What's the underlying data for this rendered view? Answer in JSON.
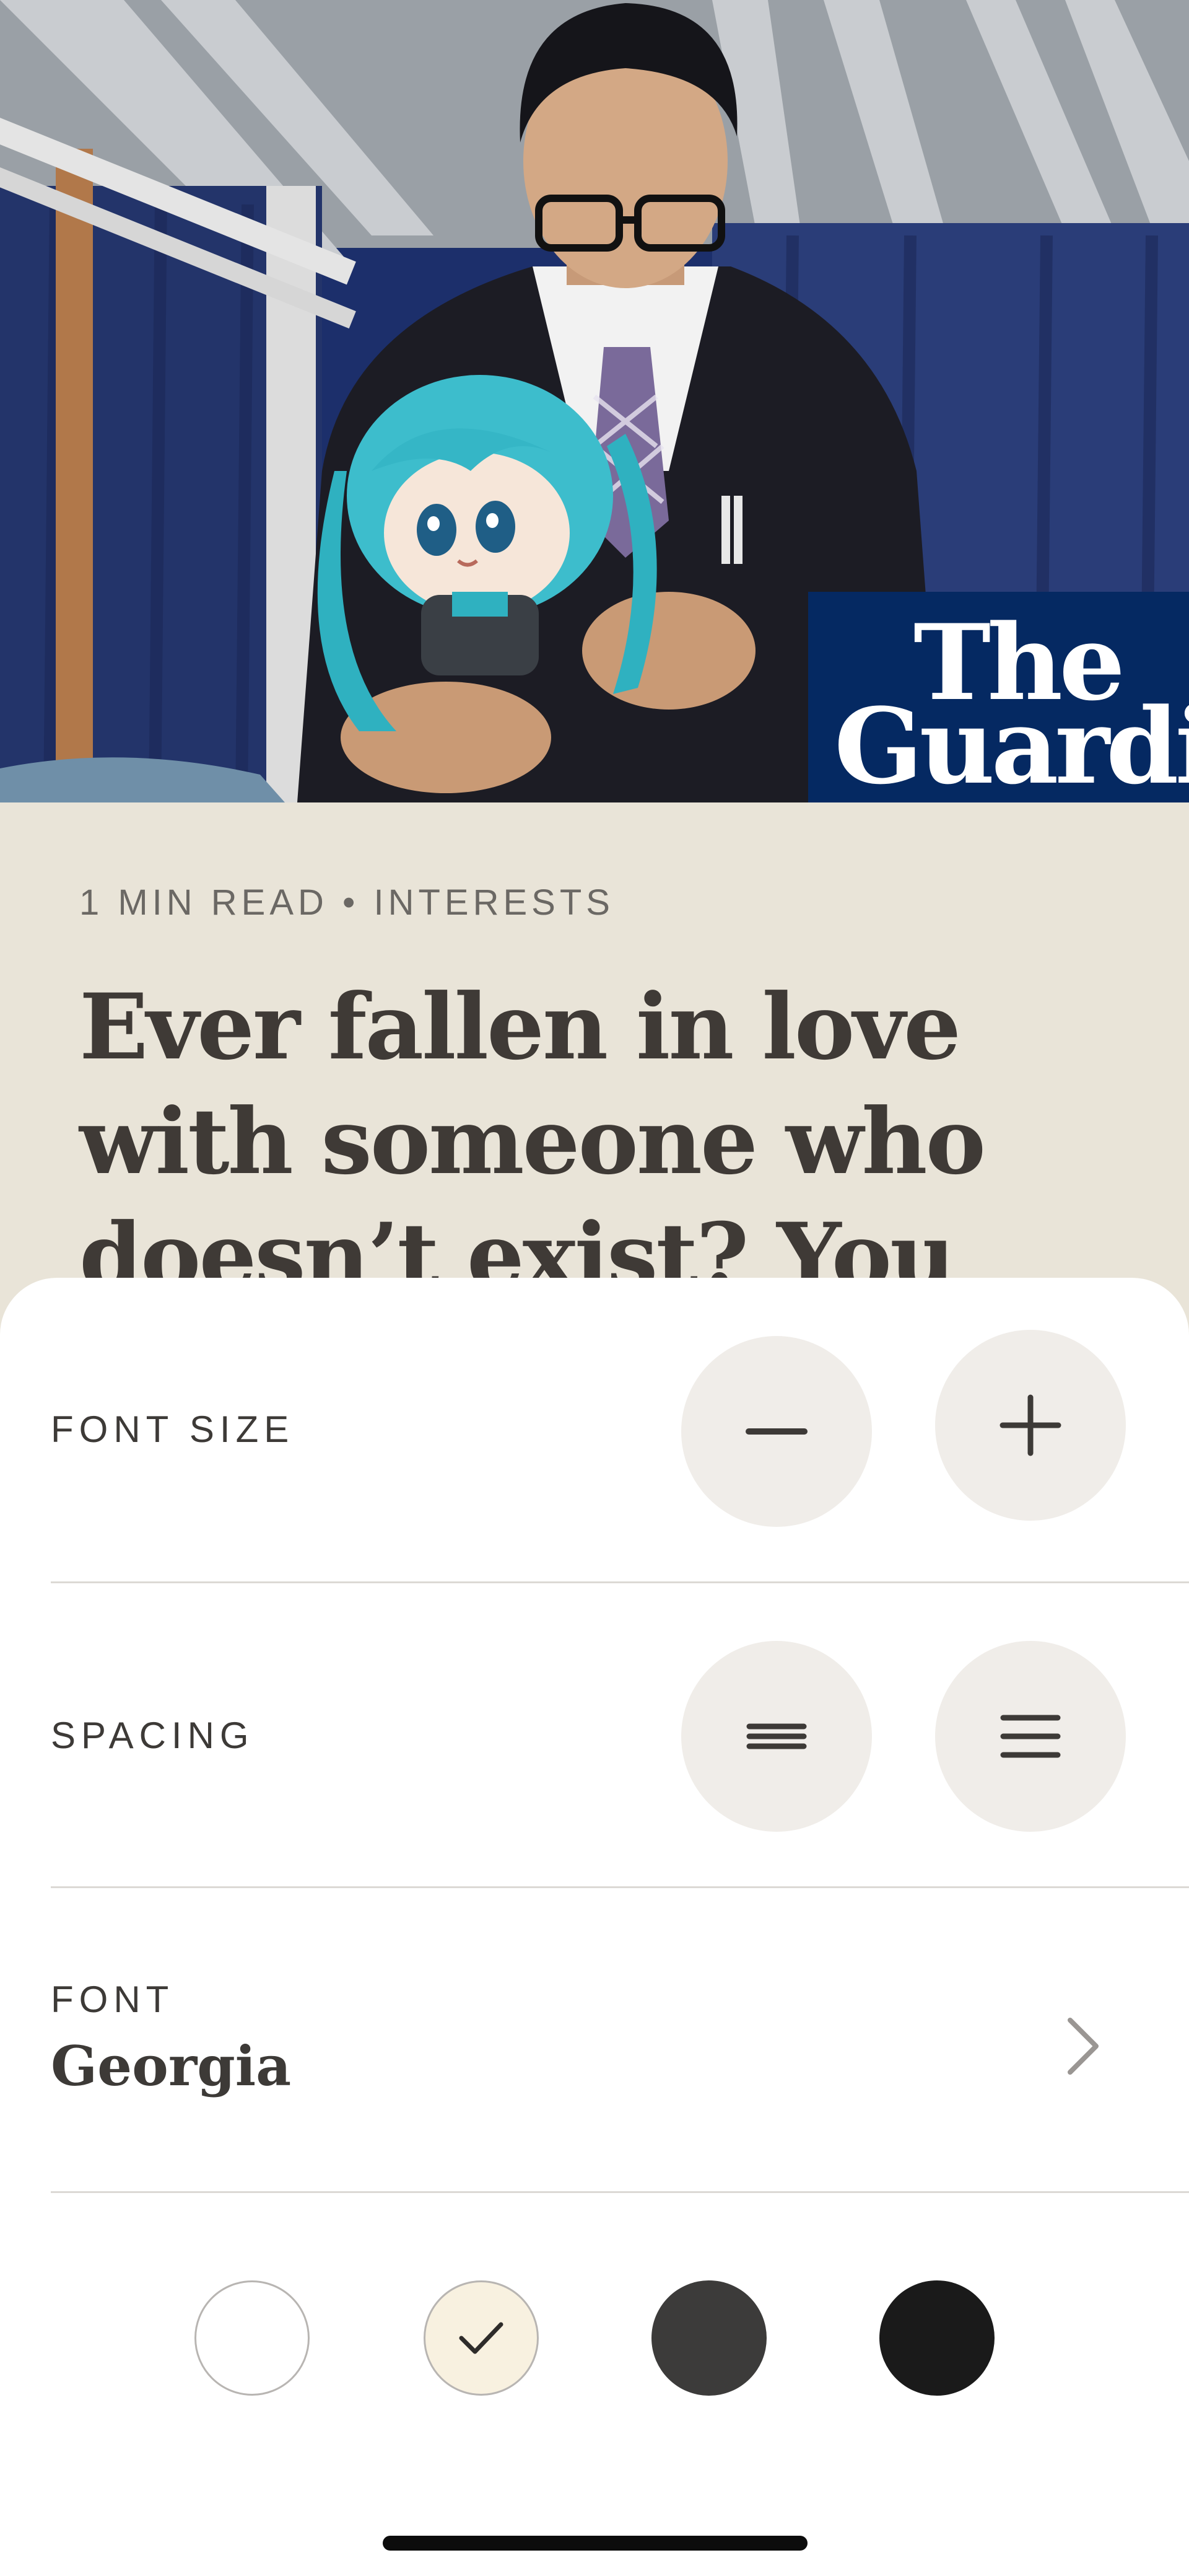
{
  "hero": {
    "image_description": "photo",
    "logo_line1": "The",
    "logo_line2": "Guardian"
  },
  "article": {
    "meta": "1 MIN READ • INTERESTS",
    "headline": "Ever fallen in love with someone who doesn’t exist? You may"
  },
  "settings": {
    "font_size": {
      "label": "FONT SIZE",
      "decrease_icon": "minus-icon",
      "increase_icon": "plus-icon"
    },
    "spacing": {
      "label": "SPACING",
      "tight_icon": "compact-lines-icon",
      "loose_icon": "spaced-lines-icon"
    },
    "font": {
      "label": "FONT",
      "value": "Georgia",
      "icon": "chevron-right-icon"
    },
    "themes": {
      "options": [
        {
          "name": "white",
          "color": "#ffffff",
          "selected": false
        },
        {
          "name": "sepia",
          "color": "#f8f1e0",
          "selected": true
        },
        {
          "name": "dark-gray",
          "color": "#3c3b3a",
          "selected": false
        },
        {
          "name": "black",
          "color": "#1a1a1a",
          "selected": false
        }
      ],
      "selected_icon": "checkmark-icon"
    }
  },
  "colors": {
    "sheet_background": "#ffffff",
    "article_background": "#e9e4d8",
    "button_background": "#f0ede9",
    "guardian_blue": "#052962",
    "text_dark": "#3d3a37"
  }
}
